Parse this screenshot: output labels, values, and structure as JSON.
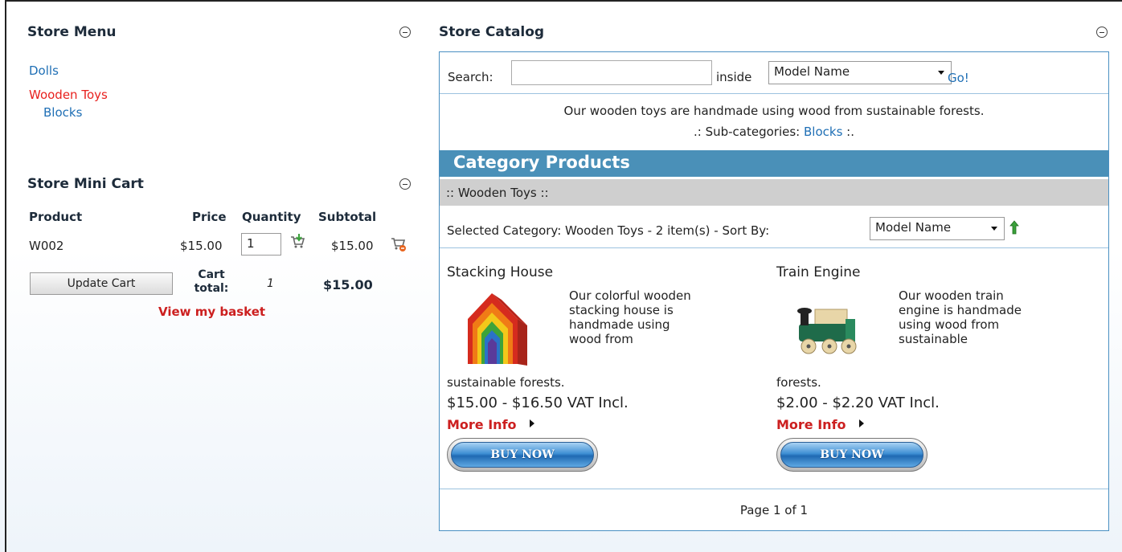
{
  "store_menu": {
    "title": "Store Menu",
    "items": [
      {
        "label": "Dolls"
      },
      {
        "label": "Wooden Toys",
        "active": true
      },
      {
        "label": "Blocks"
      }
    ]
  },
  "mini_cart": {
    "title": "Store Mini Cart",
    "headers": {
      "product": "Product",
      "price": "Price",
      "quantity": "Quantity",
      "subtotal": "Subtotal"
    },
    "rows": [
      {
        "product": "W002",
        "price": "$15.00",
        "quantity": "1",
        "subtotal": "$15.00"
      }
    ],
    "update_label": "Update Cart",
    "cart_total_label": "Cart total:",
    "cart_total_qty": "1",
    "cart_total_value": "$15.00",
    "view_basket": "View my basket"
  },
  "catalog": {
    "title": "Store Catalog",
    "search_label": "Search:",
    "search_value": "",
    "inside_label": "inside",
    "search_field": "Model Name",
    "go_label": "Go!",
    "description": "Our wooden toys are handmade using wood from sustainable forests.",
    "subcat_prefix": ".: Sub-categories: ",
    "subcat_link": "Blocks",
    "subcat_suffix": " :.",
    "products_header": "Category Products",
    "breadcrumb": ":: Wooden Toys ::",
    "selected_text": "Selected Category: Wooden Toys - 2 item(s) - Sort By:",
    "sort_field": "Model Name",
    "products": [
      {
        "name": "Stacking House",
        "desc": "Our colorful wooden stacking house is handmade using wood from",
        "desc_tail": "sustainable forests.",
        "price": "$15.00 - $16.50 VAT Incl.",
        "more_info": "More Info",
        "buy": "BUY NOW"
      },
      {
        "name": "Train Engine",
        "desc": "Our wooden train engine is handmade using wood from sustainable",
        "desc_tail": "forests.",
        "price": "$2.00 - $2.20 VAT Incl.",
        "more_info": "More Info",
        "buy": "BUY NOW"
      }
    ],
    "pager": "Page 1 of 1"
  }
}
